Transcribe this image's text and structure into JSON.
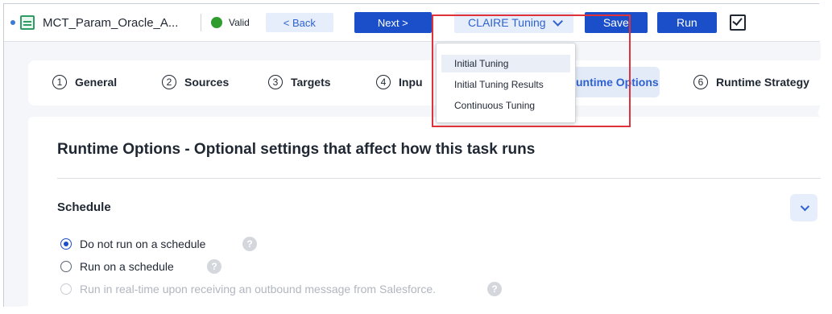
{
  "header": {
    "title": "MCT_Param_Oracle_A...",
    "status": "Valid",
    "back_label": "< Back",
    "next_label": "Next >",
    "claire_label": "CLAIRE Tuning",
    "save_label": "Save",
    "run_label": "Run"
  },
  "steps": [
    {
      "num": "1",
      "label": "General"
    },
    {
      "num": "2",
      "label": "Sources"
    },
    {
      "num": "3",
      "label": "Targets"
    },
    {
      "num": "4",
      "label": "Inpu"
    },
    {
      "num": "5",
      "label": "untime Options"
    },
    {
      "num": "6",
      "label": "Runtime Strategy"
    }
  ],
  "main": {
    "heading": "Runtime Options - Optional settings that affect how this task runs",
    "section_title": "Schedule",
    "options": [
      {
        "label": "Do not run on a schedule",
        "selected": true,
        "disabled": false
      },
      {
        "label": "Run on a schedule",
        "selected": false,
        "disabled": false
      },
      {
        "label": "Run in real-time upon receiving an outbound message from Salesforce.",
        "selected": false,
        "disabled": true
      }
    ],
    "help_glyph": "?"
  },
  "dropdown": {
    "items": [
      "Initial Tuning",
      "Initial Tuning Results",
      "Continuous Tuning"
    ]
  },
  "colors": {
    "accent": "#1a4fc9",
    "valid": "#2e9d2e",
    "highlight": "#e0323a"
  }
}
